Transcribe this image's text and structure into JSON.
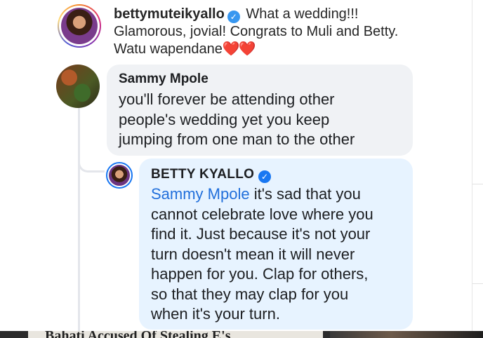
{
  "ig_comment": {
    "username": "bettymuteikyallo",
    "text": "What a wedding!!! Glamorous, jovial! Congrats to Muli and Betty. Watu wapendane",
    "hearts": "❤️❤️"
  },
  "fb_comment": {
    "name": "Sammy Mpole",
    "lines": [
      "you'll forever be attending other",
      "people's wedding yet you keep",
      "jumping from one man to the other"
    ]
  },
  "fb_reply": {
    "name": "BETTY KYALLO",
    "mention": "Sammy Mpole",
    "first_line_rest": " it's sad that you",
    "lines": [
      "cannot celebrate love where you",
      "find it. Just because it's not your",
      "turn doesn't mean it will never",
      "happen for you. Clap for others,",
      "so that they may clap for you",
      "when it's your turn."
    ]
  },
  "bottom_strip": {
    "headline": "Bahati Accused Of Stealing E's"
  },
  "colors": {
    "fb_blue": "#1877f2",
    "mention_blue": "#216fdb",
    "bubble_grey": "#f0f2f5",
    "bubble_blue": "#e7f3ff",
    "ig_verified": "#3897f0"
  }
}
